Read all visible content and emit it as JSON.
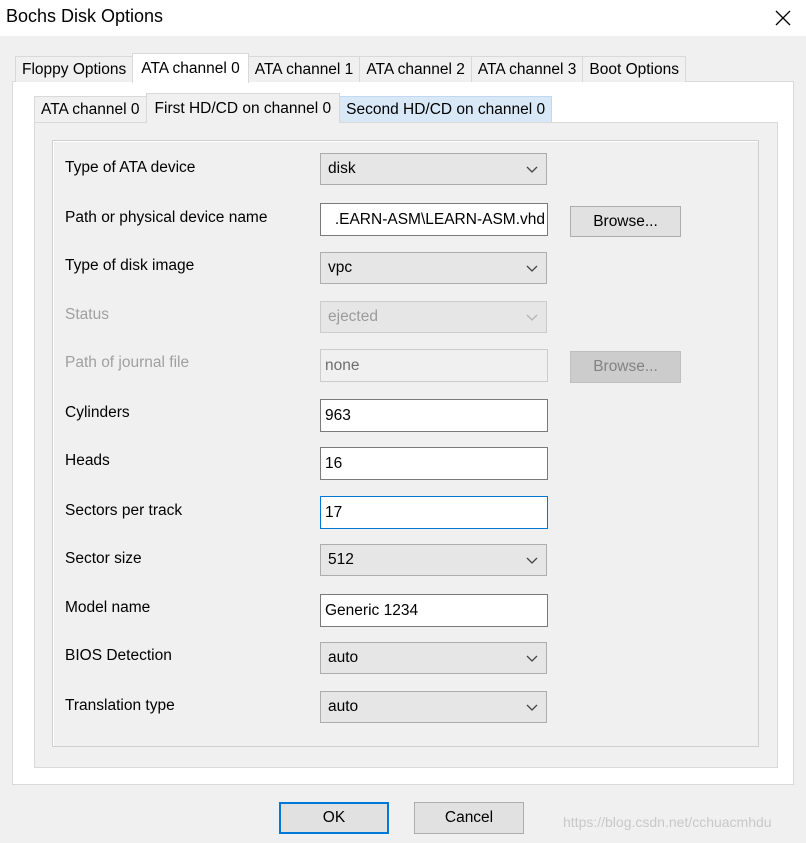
{
  "window": {
    "title": "Bochs Disk Options",
    "close_icon": "close-icon"
  },
  "main_tabs": [
    {
      "label": "Floppy Options"
    },
    {
      "label": "ATA channel 0",
      "selected": true
    },
    {
      "label": "ATA channel 1"
    },
    {
      "label": "ATA channel 2"
    },
    {
      "label": "ATA channel 3"
    },
    {
      "label": "Boot Options"
    }
  ],
  "sub_tabs": [
    {
      "label": "ATA channel 0"
    },
    {
      "label": "First HD/CD on channel 0",
      "selected": true
    },
    {
      "label": "Second HD/CD on channel 0",
      "hover": true
    }
  ],
  "form": {
    "type_of_device": {
      "label": "Type of ATA device",
      "value": "disk"
    },
    "path": {
      "label": "Path or physical device name",
      "value": ".EARN-ASM\\LEARN-ASM.vhd",
      "browse_label": "Browse..."
    },
    "image_type": {
      "label": "Type of disk image",
      "value": "vpc"
    },
    "status": {
      "label": "Status",
      "value": "ejected",
      "enabled": false
    },
    "journal": {
      "label": "Path of journal file",
      "value": "none",
      "browse_label": "Browse...",
      "enabled": false
    },
    "cylinders": {
      "label": "Cylinders",
      "value": "963"
    },
    "heads": {
      "label": "Heads",
      "value": "16"
    },
    "sectors_per_track": {
      "label": "Sectors per track",
      "value": "17",
      "focused": true
    },
    "sector_size": {
      "label": "Sector size",
      "value": "512"
    },
    "model_name": {
      "label": "Model name",
      "value": "Generic 1234"
    },
    "bios_detection": {
      "label": "BIOS Detection",
      "value": "auto"
    },
    "translation_type": {
      "label": "Translation type",
      "value": "auto"
    }
  },
  "buttons": {
    "ok": "OK",
    "cancel": "Cancel"
  },
  "watermark": "https://blog.csdn.net/cchuacmhdu",
  "colors": {
    "focus_border": "#0078d7",
    "hover_tab": "#d9e8f7",
    "dialog_bg": "#f0f0f0"
  }
}
